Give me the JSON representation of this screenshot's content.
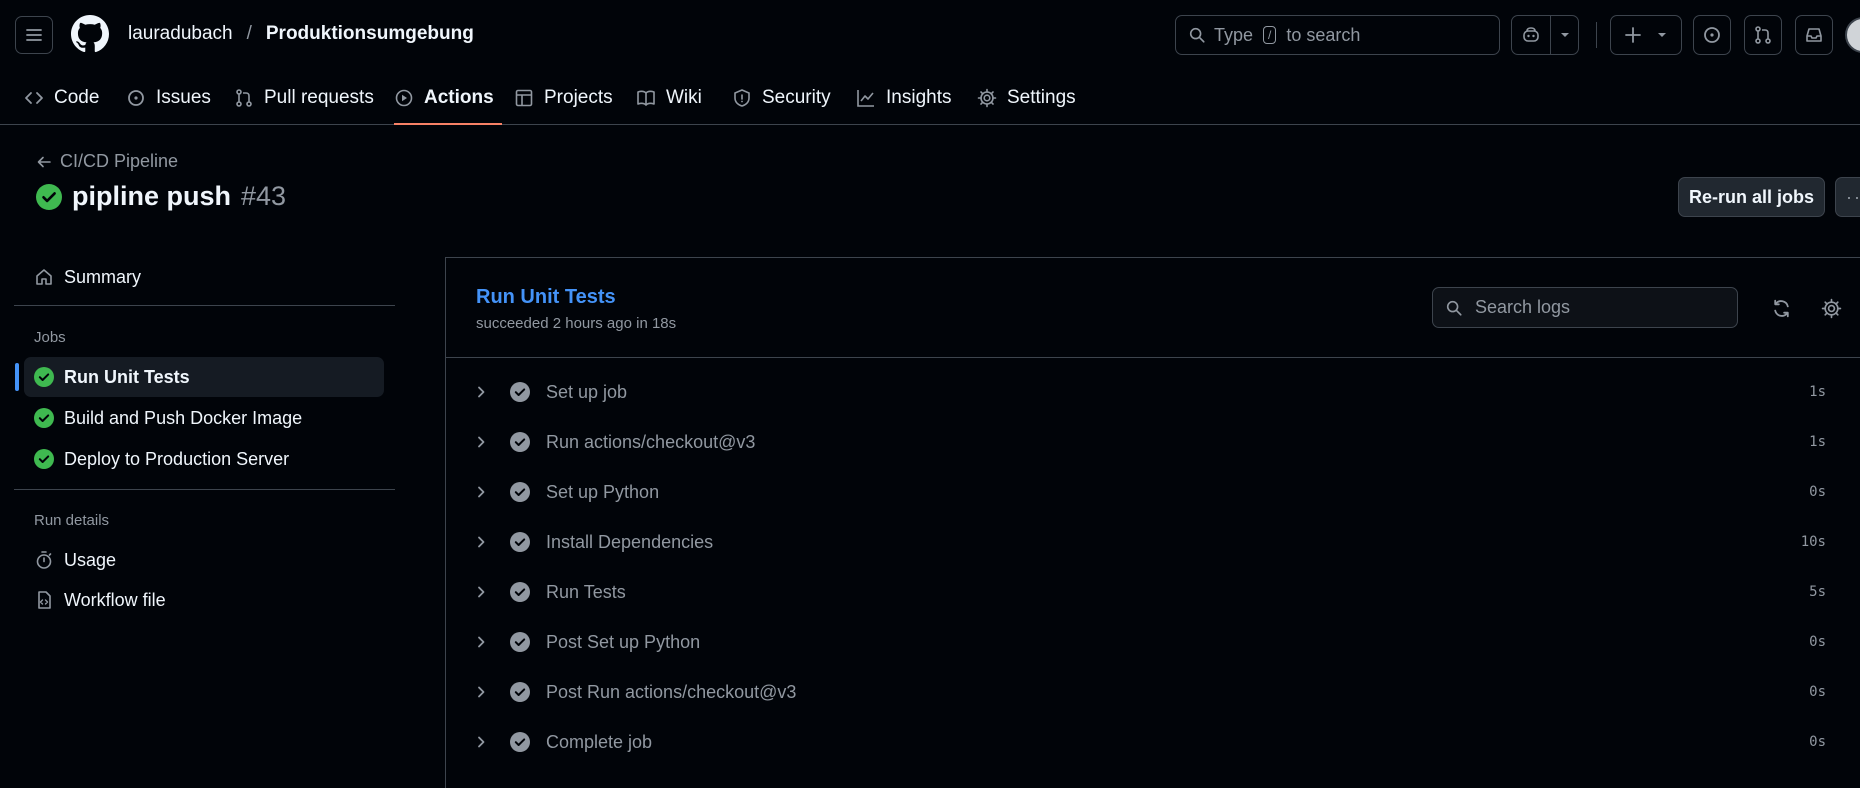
{
  "header": {
    "owner": "lauradubach",
    "separator": "/",
    "repo": "Produktionsumgebung",
    "search": {
      "prefix": "Type",
      "key": "/",
      "suffix": "to search"
    }
  },
  "tabs": [
    {
      "label": "Code",
      "icon": "code-icon"
    },
    {
      "label": "Issues",
      "icon": "issue-icon"
    },
    {
      "label": "Pull requests",
      "icon": "pull-request-icon"
    },
    {
      "label": "Actions",
      "icon": "play-icon",
      "active": true
    },
    {
      "label": "Projects",
      "icon": "table-icon"
    },
    {
      "label": "Wiki",
      "icon": "book-icon"
    },
    {
      "label": "Security",
      "icon": "shield-icon"
    },
    {
      "label": "Insights",
      "icon": "graph-icon"
    },
    {
      "label": "Settings",
      "icon": "gear-icon"
    }
  ],
  "run": {
    "workflow_link": "CI/CD Pipeline",
    "title": "pipline push",
    "number": "#43",
    "rerun_label": "Re-run all jobs",
    "more_label": "···"
  },
  "sidebar": {
    "summary": "Summary",
    "jobs_heading": "Jobs",
    "jobs": [
      {
        "label": "Run Unit Tests",
        "selected": true
      },
      {
        "label": "Build and Push Docker Image"
      },
      {
        "label": "Deploy to Production Server"
      }
    ],
    "details_heading": "Run details",
    "usage": "Usage",
    "workflow_file": "Workflow file"
  },
  "job": {
    "title": "Run Unit Tests",
    "subtitle": "succeeded 2 hours ago in 18s",
    "search_placeholder": "Search logs",
    "steps": [
      {
        "label": "Set up job",
        "duration": "1s"
      },
      {
        "label": "Run actions/checkout@v3",
        "duration": "1s"
      },
      {
        "label": "Set up Python",
        "duration": "0s"
      },
      {
        "label": "Install Dependencies",
        "duration": "10s"
      },
      {
        "label": "Run Tests",
        "duration": "5s"
      },
      {
        "label": "Post Set up Python",
        "duration": "0s"
      },
      {
        "label": "Post Run actions/checkout@v3",
        "duration": "0s"
      },
      {
        "label": "Complete job",
        "duration": "0s"
      }
    ]
  },
  "colors": {
    "success": "#3fb950",
    "accent": "#4493f8",
    "active_tab": "#f78166"
  }
}
